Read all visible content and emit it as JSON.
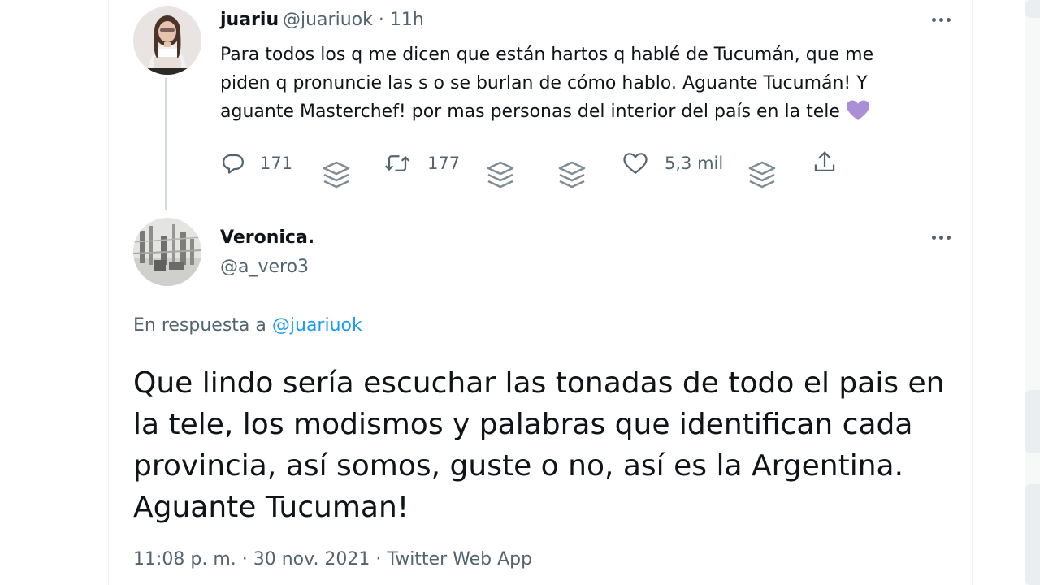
{
  "tweet1": {
    "display_name": "juariu",
    "handle": "@juariuok",
    "separator": "·",
    "time": "11h",
    "text_lines": [
      "Para todos los q me dicen que están hartos q hablé de Tucumán, que me",
      "piden q pronuncie las s o se burlan de cómo hablo. Aguante Tucumán! Y",
      "aguante Masterchef! por mas personas del interior del país en la tele"
    ],
    "emoji": "purple-heart",
    "actions": {
      "replies": "171",
      "retweets": "177",
      "likes": "5,3 mil"
    }
  },
  "tweet2": {
    "display_name": "Veronica.",
    "handle": "@a_vero3",
    "reply_prefix": "En respuesta a",
    "reply_handle": "@juariuok",
    "text_lines": [
      "Que lindo sería escuchar las tonadas de todo el pais en",
      "la tele, los modismos y palabras que identifican cada",
      "provincia, así somos, guste o no, así es la Argentina.",
      "Aguante Tucuman!"
    ],
    "meta": "11:08 p. m. · 30 nov. 2021 · Twitter Web App"
  },
  "colors": {
    "text": "#0f1419",
    "muted": "#536471",
    "link": "#1d9bf0",
    "thread_line": "#cfd9de",
    "heart_emoji": "#aa8ed6"
  },
  "icons": [
    "reply-icon",
    "retweet-icon",
    "like-icon",
    "share-icon",
    "layers-icon",
    "more-icon",
    "purple-heart-emoji"
  ]
}
